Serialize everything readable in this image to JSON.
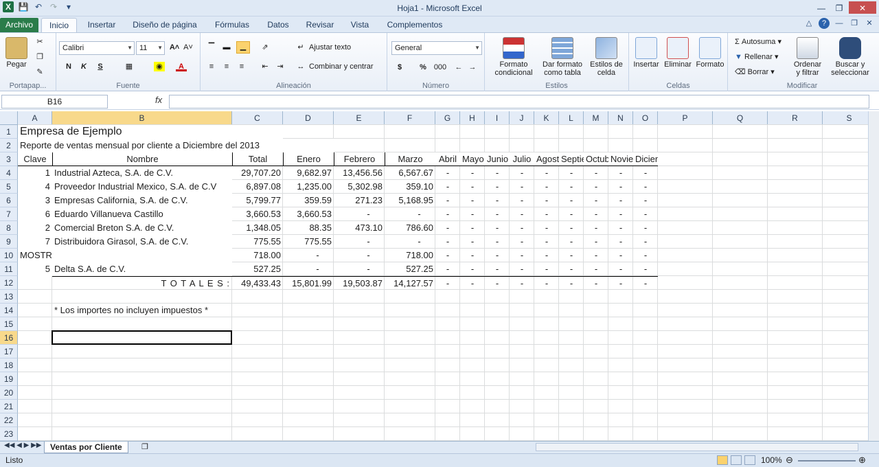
{
  "window": {
    "title": "Hoja1 - Microsoft Excel"
  },
  "tabs": [
    "Archivo",
    "Inicio",
    "Insertar",
    "Diseño de página",
    "Fórmulas",
    "Datos",
    "Revisar",
    "Vista",
    "Complementos"
  ],
  "ribbon": {
    "paste_label": "Pegar",
    "font_name": "Calibri",
    "font_size": "11",
    "bold": "N",
    "italic": "K",
    "underline": "S",
    "wrap_text": "Ajustar texto",
    "merge_center": "Combinar y centrar",
    "number_format": "General",
    "currency": "$",
    "percent": "%",
    "thousands": "000",
    "cond_format_1": "Formato",
    "cond_format_2": "condicional",
    "table_format_1": "Dar formato",
    "table_format_2": "como tabla",
    "cell_styles_1": "Estilos de",
    "cell_styles_2": "celda",
    "insert": "Insertar",
    "delete": "Eliminar",
    "format": "Formato",
    "autosum": "Autosuma",
    "fill": "Rellenar",
    "clear": "Borrar",
    "sort_1": "Ordenar",
    "sort_2": "y filtrar",
    "find_1": "Buscar y",
    "find_2": "seleccionar",
    "groups": {
      "clipboard": "Portapap...",
      "font": "Fuente",
      "alignment": "Alineación",
      "number": "Número",
      "styles": "Estilos",
      "cells": "Celdas",
      "editing": "Modificar"
    }
  },
  "formula_bar": {
    "name_box": "B16",
    "fx": "fx",
    "content": ""
  },
  "columns": [
    "A",
    "B",
    "C",
    "D",
    "E",
    "F",
    "G",
    "H",
    "I",
    "J",
    "K",
    "L",
    "M",
    "N",
    "O",
    "P",
    "Q",
    "R",
    "S"
  ],
  "rows": [
    "1",
    "2",
    "3",
    "4",
    "5",
    "6",
    "7",
    "8",
    "9",
    "10",
    "11",
    "12",
    "13",
    "14",
    "15",
    "16",
    "17",
    "18",
    "19",
    "20",
    "21",
    "22",
    "23"
  ],
  "sheet": {
    "title": "Empresa de Ejemplo",
    "subtitle": "Reporte de ventas mensual por cliente a Diciembre del 2013",
    "headers": [
      "Clave",
      "Nombre",
      "Total",
      "Enero",
      "Febrero",
      "Marzo",
      "Abril",
      "Mayo",
      "Junio",
      "Julio",
      "Agosto",
      "Septiembre",
      "Octubre",
      "Noviembre",
      "Diciembre"
    ],
    "data": [
      [
        "1",
        "Industrial Azteca, S.A. de C.V.",
        "29,707.20",
        "9,682.97",
        "13,456.56",
        "6,567.67"
      ],
      [
        "4",
        "Proveedor Industrial Mexico, S.A. de C.V",
        "6,897.08",
        "1,235.00",
        "5,302.98",
        "359.10"
      ],
      [
        "3",
        "Empresas California, S.A. de C.V.",
        "5,799.77",
        "359.59",
        "271.23",
        "5,168.95"
      ],
      [
        "6",
        "Eduardo Villanueva Castillo",
        "3,660.53",
        "3,660.53",
        "-",
        "-"
      ],
      [
        "2",
        "Comercial Breton S.A. de C.V.",
        "1,348.05",
        "88.35",
        "473.10",
        "786.60"
      ],
      [
        "7",
        "Distribuidora Girasol, S.A. de C.V.",
        "775.55",
        "775.55",
        "-",
        "-"
      ],
      [
        "MOSTR",
        "",
        "718.00",
        "-",
        "-",
        "718.00"
      ],
      [
        "5",
        "Delta S.A. de C.V.",
        "527.25",
        "-",
        "-",
        "527.25"
      ]
    ],
    "totals_label": "T O T A L E S :",
    "totals": [
      "49,433.43",
      "15,801.99",
      "19,503.87",
      "14,127.57"
    ],
    "dash": "-",
    "note": "* Los importes no incluyen impuestos *"
  },
  "sheet_tab": "Ventas por Cliente",
  "status": {
    "ready": "Listo",
    "zoom": "100%"
  }
}
